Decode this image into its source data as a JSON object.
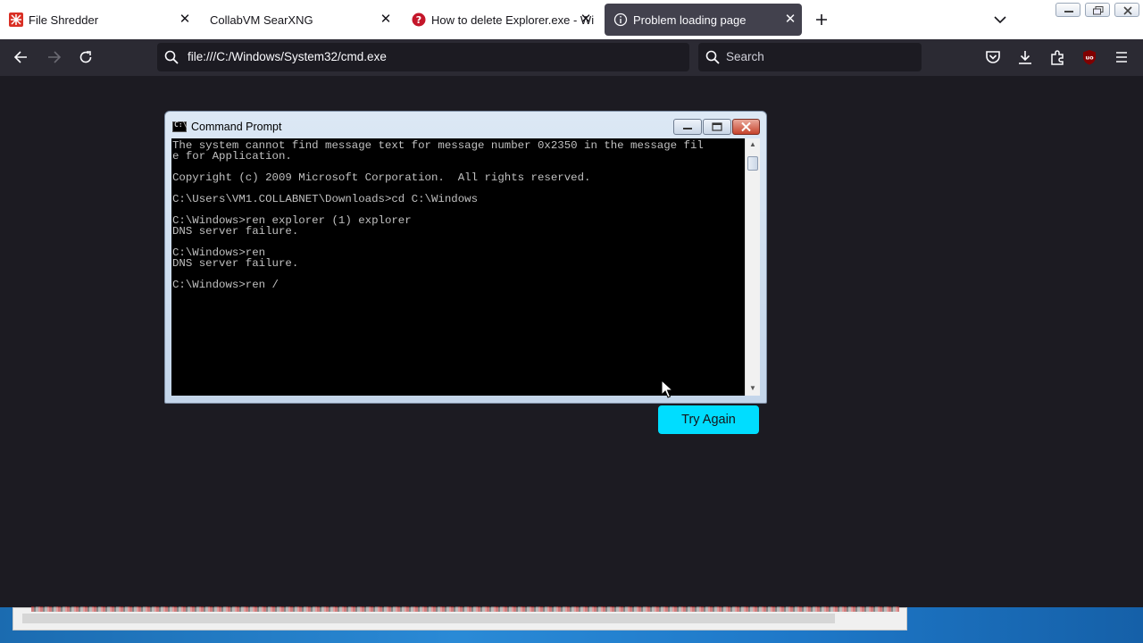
{
  "browser": {
    "tabs": [
      {
        "title": "File Shredder",
        "favicon": "file-shredder-icon"
      },
      {
        "title": "CollabVM SearXNG",
        "favicon": "none"
      },
      {
        "title": "How to delete Explorer.exe - Wi",
        "favicon": "help-icon"
      },
      {
        "title": "Problem loading page",
        "favicon": "info-icon",
        "active": true
      }
    ],
    "url": "file:///C:/Windows/System32/cmd.exe",
    "search_placeholder": "Search"
  },
  "cmd_window": {
    "title": "Command Prompt",
    "lines": [
      "The system cannot find message text for message number 0x2350 in the message fil",
      "e for Application.",
      "",
      "Copyright (c) 2009 Microsoft Corporation.  All rights reserved.",
      "",
      "C:\\Users\\VM1.COLLABNET\\Downloads>cd C:\\Windows",
      "",
      "C:\\Windows>ren explorer (1) explorer",
      "DNS server failure.",
      "",
      "C:\\Windows>ren",
      "DNS server failure.",
      "",
      "C:\\Windows>ren /"
    ]
  },
  "page": {
    "try_again_label": "Try Again"
  },
  "colors": {
    "accent": "#00ddff",
    "toolbar": "#2b2a33",
    "content_bg": "#1c1b22",
    "ublock": "#800000"
  }
}
